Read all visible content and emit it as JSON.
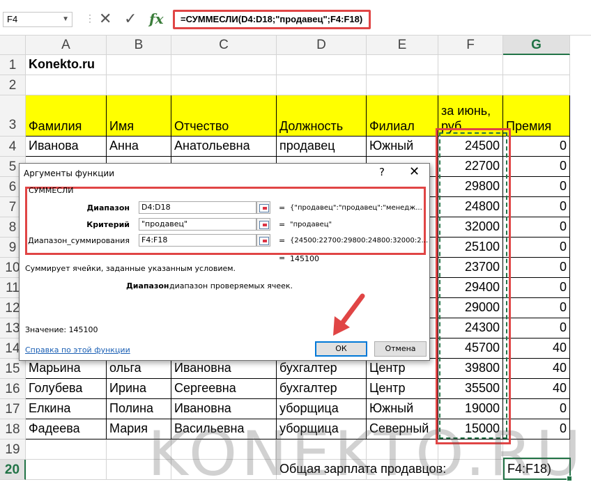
{
  "formula_bar": {
    "name_box": "F4",
    "cancel_icon": "✕",
    "enter_icon": "✓",
    "fx_icon": "fx",
    "formula": "=СУММЕСЛИ(D4:D18;\"продавец\";F4:F18)"
  },
  "columns": [
    "A",
    "B",
    "C",
    "D",
    "E",
    "F",
    "G"
  ],
  "rows": [
    "1",
    "2",
    "3",
    "4",
    "5",
    "6",
    "7",
    "8",
    "9",
    "10",
    "11",
    "12",
    "13",
    "14",
    "15",
    "16",
    "17",
    "18",
    "19",
    "20"
  ],
  "sheet": {
    "a1": "Konekto.ru",
    "headers": [
      "Фамилия",
      "Имя",
      "Отчество",
      "Должность",
      "Филиал",
      "за июнь, руб.",
      "Премия"
    ],
    "data_rows": [
      [
        "Иванова",
        "Анна",
        "Анатольевна",
        "продавец",
        "Южный",
        "24500",
        "0"
      ],
      [
        "",
        "",
        "",
        "",
        "",
        "22700",
        "0"
      ],
      [
        "",
        "",
        "",
        "",
        "",
        "29800",
        "0"
      ],
      [
        "",
        "",
        "",
        "",
        "",
        "24800",
        "0"
      ],
      [
        "",
        "",
        "",
        "",
        "",
        "32000",
        "0"
      ],
      [
        "",
        "",
        "",
        "",
        "",
        "25100",
        "0"
      ],
      [
        "",
        "",
        "",
        "",
        "",
        "23700",
        "0"
      ],
      [
        "",
        "",
        "",
        "",
        "",
        "29400",
        "0"
      ],
      [
        "",
        "",
        "",
        "",
        "",
        "29000",
        "0"
      ],
      [
        "",
        "",
        "",
        "",
        "",
        "24300",
        "0"
      ],
      [
        "",
        "",
        "",
        "",
        "",
        "45700",
        "40"
      ],
      [
        "Марьина",
        "ольга",
        "Ивановна",
        "бухгалтер",
        "Центр",
        "39800",
        "40"
      ],
      [
        "Голубева",
        "Ирина",
        "Сергеевна",
        "бухгалтер",
        "Центр",
        "35500",
        "40"
      ],
      [
        "Елкина",
        "Полина",
        "Ивановна",
        "уборщица",
        "Южный",
        "19000",
        "0"
      ],
      [
        "Фадеева",
        "Мария",
        "Васильевна",
        "уборщица",
        "Северный",
        "15000",
        "0"
      ]
    ],
    "total_label": "Общая зарплата продавцов:",
    "g20": "F4:F18)"
  },
  "watermark": "KONEKTO.RU",
  "dialog": {
    "title": "Аргументы функции",
    "help": "?",
    "close": "✕",
    "function_name": "СУММЕСЛИ",
    "args": [
      {
        "label": "Диапазон",
        "value": "D4:D18",
        "result": "{\"продавец\":\"продавец\":\"менедж..."
      },
      {
        "label": "Критерий",
        "value": "\"продавец\"",
        "result": "\"продавец\""
      },
      {
        "label": "Диапазон_суммирования",
        "value": "F4:F18",
        "result": "{24500:22700:29800:24800:32000:2..."
      }
    ],
    "equals": "=",
    "result_total": "145100",
    "description": "Суммирует ячейки, заданные указанным условием.",
    "arg_name": "Диапазон",
    "arg_desc": "диапазон проверяемых ячеек.",
    "value_label": "Значение:   145100",
    "help_link": "Справка по этой функции",
    "ok": "ОК",
    "cancel": "Отмена"
  },
  "colors": {
    "accent_red": "#e04545",
    "excel_green": "#217346",
    "header_yellow": "#ffff00"
  }
}
